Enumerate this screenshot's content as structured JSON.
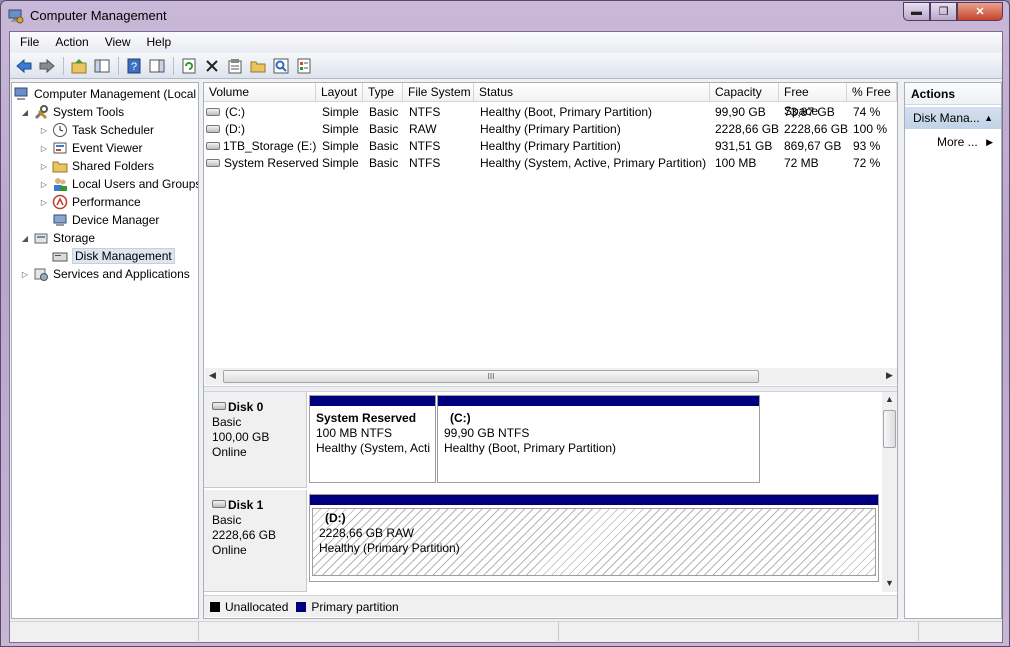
{
  "window": {
    "title": "Computer Management"
  },
  "menu": [
    "File",
    "Action",
    "View",
    "Help"
  ],
  "tree": {
    "root": "Computer Management (Local",
    "system_tools": "System Tools",
    "task_scheduler": "Task Scheduler",
    "event_viewer": "Event Viewer",
    "shared_folders": "Shared Folders",
    "local_users": "Local Users and Groups",
    "performance": "Performance",
    "device_manager": "Device Manager",
    "storage": "Storage",
    "disk_management": "Disk Management",
    "services": "Services and Applications"
  },
  "volumes": {
    "headers": [
      "Volume",
      "Layout",
      "Type",
      "File System",
      "Status",
      "Capacity",
      "Free Space",
      "% Free"
    ],
    "rows": [
      [
        "(C:)",
        "Simple",
        "Basic",
        "NTFS",
        "Healthy (Boot, Primary Partition)",
        "99,90 GB",
        "73,87 GB",
        "74 %"
      ],
      [
        "(D:)",
        "Simple",
        "Basic",
        "RAW",
        "Healthy (Primary Partition)",
        "2228,66 GB",
        "2228,66 GB",
        "100 %"
      ],
      [
        "1TB_Storage (E:)",
        "Simple",
        "Basic",
        "NTFS",
        "Healthy (Primary Partition)",
        "931,51 GB",
        "869,67 GB",
        "93 %"
      ],
      [
        "System Reserved",
        "Simple",
        "Basic",
        "NTFS",
        "Healthy (System, Active, Primary Partition)",
        "100 MB",
        "72 MB",
        "72 %"
      ]
    ]
  },
  "disks": {
    "disk0": {
      "name": "Disk 0",
      "type": "Basic",
      "size": "100,00 GB",
      "state": "Online",
      "p1": {
        "name": "System Reserved",
        "size": "100 MB NTFS",
        "status": "Healthy (System, Acti"
      },
      "p2": {
        "name": "(C:)",
        "size": "99,90 GB NTFS",
        "status": "Healthy (Boot, Primary Partition)"
      }
    },
    "disk1": {
      "name": "Disk 1",
      "type": "Basic",
      "size": "2228,66 GB",
      "state": "Online",
      "p1": {
        "name": "(D:)",
        "size": "2228,66 GB RAW",
        "status": "Healthy (Primary Partition)"
      }
    }
  },
  "legend": {
    "unallocated": "Unallocated",
    "primary": "Primary partition",
    "unallocated_color": "#000000",
    "primary_color": "#00007f"
  },
  "actions": {
    "title": "Actions",
    "section": "Disk Mana...",
    "more": "More ..."
  },
  "scroll_grip": "III"
}
